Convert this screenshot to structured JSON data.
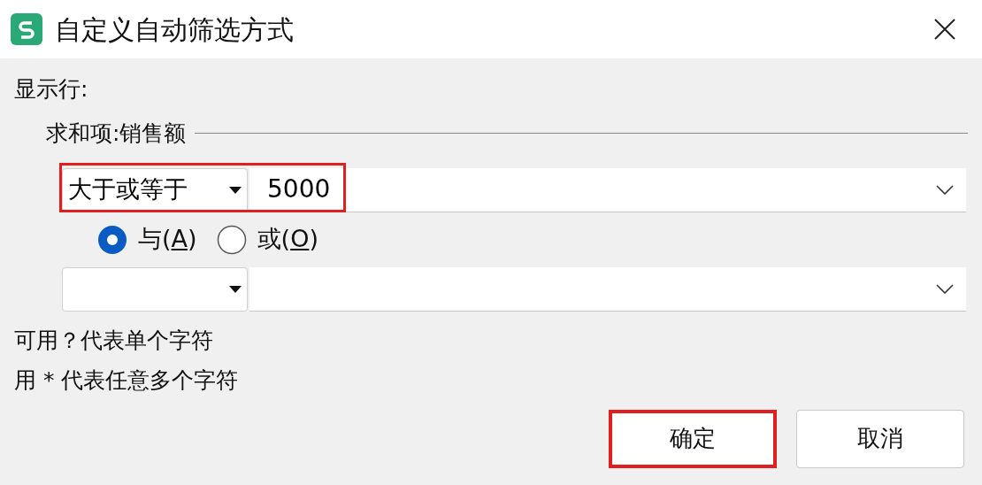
{
  "window": {
    "title": "自定义自动筛选方式"
  },
  "section_label": "显示行:",
  "field_label": "求和项:销售额",
  "conditions": [
    {
      "operator": "大于或等于",
      "value": "5000",
      "highlighted": true
    },
    {
      "highlighted": false
    }
  ],
  "logic": [
    {
      "before": "与(",
      "mnemonic": "A",
      "after": ")",
      "selected": true
    },
    {
      "before": "或(",
      "mnemonic": "O",
      "after": ")",
      "selected": false
    }
  ],
  "hints": [
    "可用？代表单个字符",
    "用 * 代表任意多个字符"
  ],
  "buttons": [
    {
      "label": "确定",
      "highlighted": true
    },
    {
      "label": "取消",
      "highlighted": false
    }
  ]
}
